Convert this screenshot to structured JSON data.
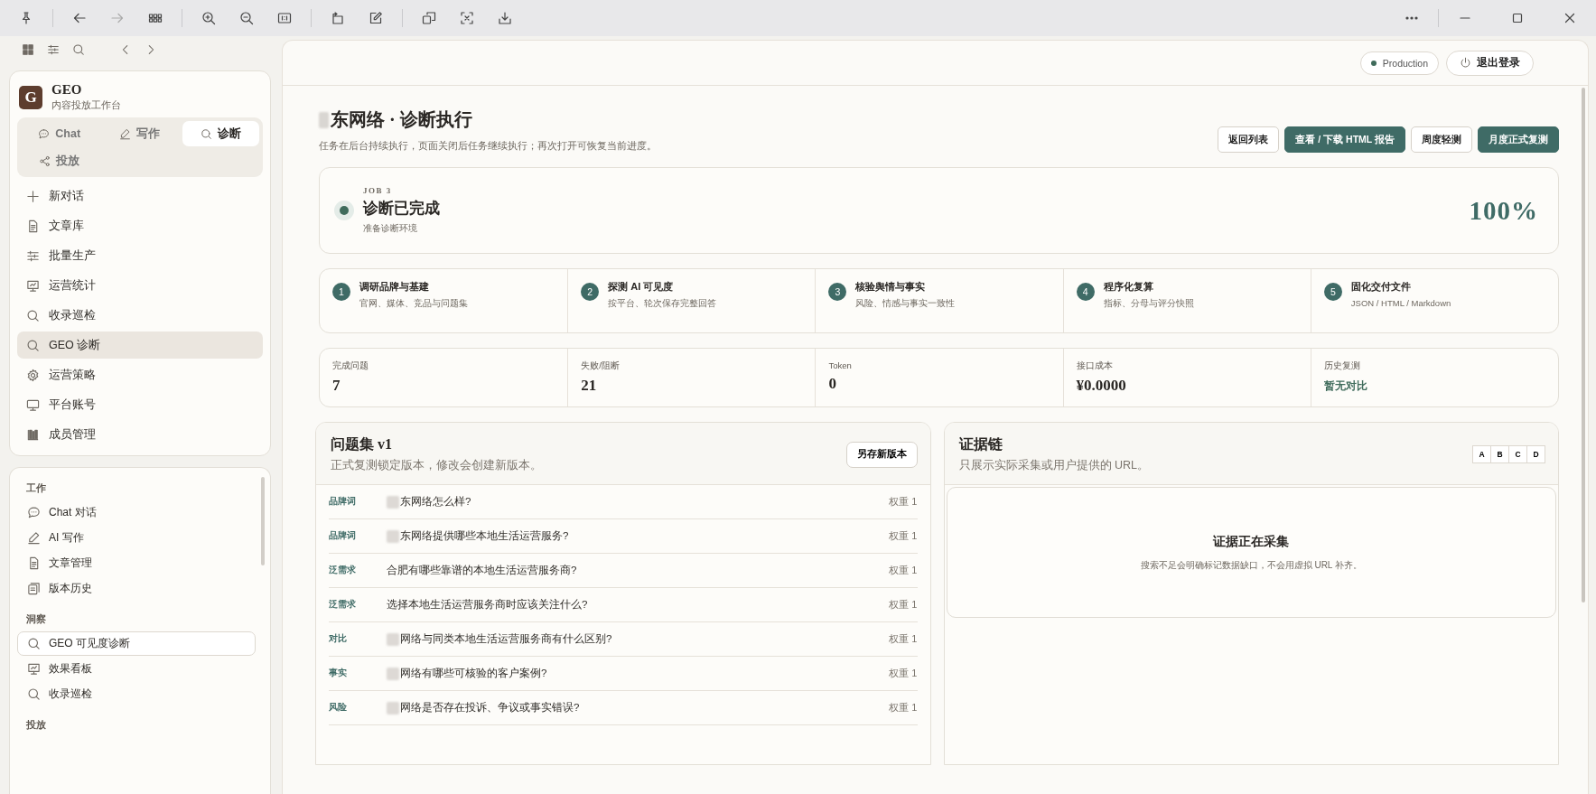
{
  "app": {
    "name": "GEO",
    "subtitle": "内容投放工作台",
    "logo": "G"
  },
  "mode_tabs": [
    {
      "label": "Chat",
      "selected": false
    },
    {
      "label": "写作",
      "selected": false
    },
    {
      "label": "诊断",
      "selected": true
    },
    {
      "label": "投放",
      "selected": false
    }
  ],
  "nav": [
    {
      "label": "新对话",
      "selected": false
    },
    {
      "label": "文章库",
      "selected": false
    },
    {
      "label": "批量生产",
      "selected": false
    },
    {
      "label": "运营统计",
      "selected": false
    },
    {
      "label": "收录巡检",
      "selected": false
    },
    {
      "label": "GEO 诊断",
      "selected": true
    },
    {
      "label": "运营策略",
      "selected": false
    },
    {
      "label": "平台账号",
      "selected": false
    },
    {
      "label": "成员管理",
      "selected": false
    }
  ],
  "sections": [
    {
      "title": "工作",
      "items": [
        {
          "label": "Chat 对话",
          "selected": false
        },
        {
          "label": "AI 写作",
          "selected": false
        },
        {
          "label": "文章管理",
          "selected": false
        },
        {
          "label": "版本历史",
          "selected": false
        }
      ]
    },
    {
      "title": "洞察",
      "items": [
        {
          "label": "GEO 可见度诊断",
          "selected": true
        },
        {
          "label": "效果看板",
          "selected": false
        },
        {
          "label": "收录巡检",
          "selected": false
        }
      ]
    },
    {
      "title": "投放"
    }
  ],
  "header": {
    "environment": "Production",
    "logout": "退出登录"
  },
  "page": {
    "title": "东网络 · 诊断执行",
    "redacted": true,
    "subtitle": "任务在后台持续执行，页面关闭后任务继续执行；再次打开可恢复当前进度。",
    "actions": [
      {
        "label": "返回列表",
        "kind": "outline"
      },
      {
        "label": "查看 / 下载 HTML 报告",
        "kind": "primary"
      },
      {
        "label": "周度轻测",
        "kind": "outline"
      },
      {
        "label": "月度正式复测",
        "kind": "primary"
      }
    ]
  },
  "job": {
    "tag": "JOB 3",
    "status": "诊断已完成",
    "detail": "准备诊断环境",
    "percent": "100%"
  },
  "steps": [
    {
      "number": "1",
      "title": "调研品牌与基建",
      "desc": "官网、媒体、竞品与问题集"
    },
    {
      "number": "2",
      "title": "探测 AI 可见度",
      "desc": "按平台、轮次保存完整回答"
    },
    {
      "number": "3",
      "title": "核验舆情与事实",
      "desc": "风险、情感与事实一致性"
    },
    {
      "number": "4",
      "title": "程序化复算",
      "desc": "指标、分母与评分快照"
    },
    {
      "number": "5",
      "title": "固化交付文件",
      "desc": "JSON / HTML / Markdown"
    }
  ],
  "metrics": [
    {
      "label": "完成问题",
      "value": "7",
      "kind": "number"
    },
    {
      "label": "失败/阻断",
      "value": "21",
      "kind": "number"
    },
    {
      "label": "Token",
      "value": "0",
      "kind": "number"
    },
    {
      "label": "接口成本",
      "value": "¥0.0000",
      "kind": "number"
    },
    {
      "label": "历史复测",
      "value": "暂无对比",
      "kind": "text"
    }
  ],
  "questions": {
    "title": "问题集 v1",
    "subtitle": "正式复测锁定版本，修改会创建新版本。",
    "save": "另存新版本",
    "rows": [
      {
        "tag": "品牌词",
        "text": "东网络怎么样?",
        "redacted": true,
        "weight": "权重 1"
      },
      {
        "tag": "品牌词",
        "text": "东网络提供哪些本地生活运营服务?",
        "redacted": true,
        "weight": "权重 1"
      },
      {
        "tag": "泛需求",
        "text": "合肥有哪些靠谱的本地生活运营服务商?",
        "redacted": false,
        "weight": "权重 1"
      },
      {
        "tag": "泛需求",
        "text": "选择本地生活运营服务商时应该关注什么?",
        "redacted": false,
        "weight": "权重 1"
      },
      {
        "tag": "对比",
        "text": "网络与同类本地生活运营服务商有什么区别?",
        "redacted": true,
        "weight": "权重 1"
      },
      {
        "tag": "事实",
        "text": "网络有哪些可核验的客户案例?",
        "redacted": true,
        "weight": "权重 1"
      },
      {
        "tag": "风险",
        "text": "网络是否存在投诉、争议或事实错误?",
        "redacted": true,
        "weight": "权重 1"
      }
    ]
  },
  "evidence": {
    "title": "证据链",
    "subtitle": "只展示实际采集或用户提供的 URL。",
    "filters": [
      "A",
      "B",
      "C",
      "D"
    ],
    "empty_title": "证据正在采集",
    "empty_text": "搜索不足会明确标记数据缺口，不会用虚拟 URL 补齐。"
  }
}
